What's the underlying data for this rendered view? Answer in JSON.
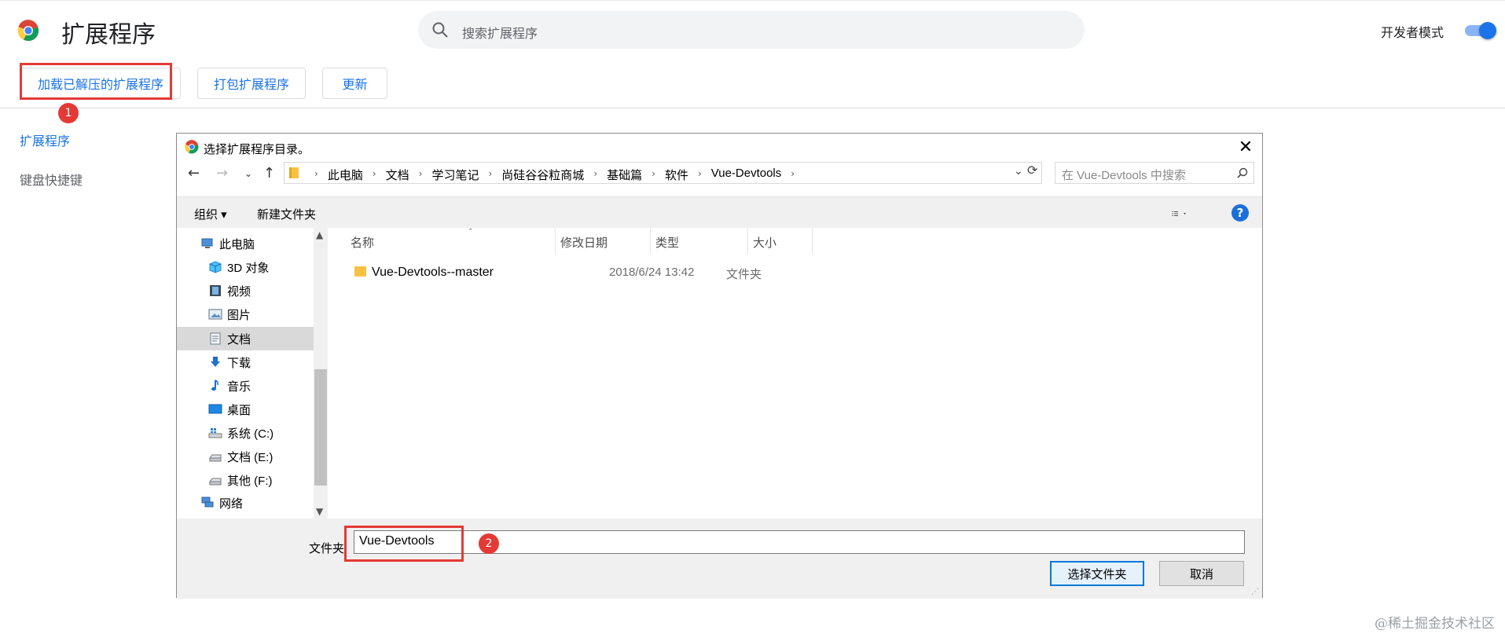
{
  "page": {
    "title": "扩展程序",
    "search_placeholder": "搜索扩展程序",
    "developer_mode_label": "开发者模式",
    "developer_mode_on": true
  },
  "toolbar": {
    "load_unpacked": "加载已解压的扩展程序",
    "pack_extension": "打包扩展程序",
    "update": "更新"
  },
  "sidebar": {
    "items": [
      "扩展程序",
      "键盘快捷键"
    ]
  },
  "annotations": {
    "badge1": "1",
    "badge2": "2",
    "highlight_color": "#e53935"
  },
  "dialog": {
    "title": "选择扩展程序目录。",
    "close_glyph": "✕",
    "breadcrumbs": [
      "此电脑",
      "文档",
      "学习笔记",
      "尚硅谷谷粒商城",
      "基础篇",
      "软件",
      "Vue-Devtools"
    ],
    "search_placeholder": "在 Vue-Devtools 中搜索",
    "organize": "组织 ▾",
    "new_folder": "新建文件夹",
    "help": "?",
    "nav_items": [
      {
        "label": "此电脑",
        "icon": "computer-icon"
      },
      {
        "label": "3D 对象",
        "icon": "cube-icon"
      },
      {
        "label": "视频",
        "icon": "film-icon"
      },
      {
        "label": "图片",
        "icon": "picture-icon"
      },
      {
        "label": "文档",
        "icon": "document-icon"
      },
      {
        "label": "下载",
        "icon": "download-icon"
      },
      {
        "label": "音乐",
        "icon": "music-icon"
      },
      {
        "label": "桌面",
        "icon": "desktop-icon"
      },
      {
        "label": "系统 (C:)",
        "icon": "drive-c-icon"
      },
      {
        "label": "文档 (E:)",
        "icon": "drive-icon"
      },
      {
        "label": "其他 (F:)",
        "icon": "drive-icon"
      },
      {
        "label": "网络",
        "icon": "network-icon"
      }
    ],
    "columns": [
      "名称",
      "修改日期",
      "类型",
      "大小"
    ],
    "files": [
      {
        "name": "Vue-Devtools--master",
        "date": "2018/6/24 13:42",
        "type": "文件夹",
        "size": ""
      }
    ],
    "folder_label": "文件夹:",
    "folder_value": "Vue-Devtools",
    "select_button": "选择文件夹",
    "cancel_button": "取消"
  },
  "watermark": "@稀土掘金技术社区"
}
